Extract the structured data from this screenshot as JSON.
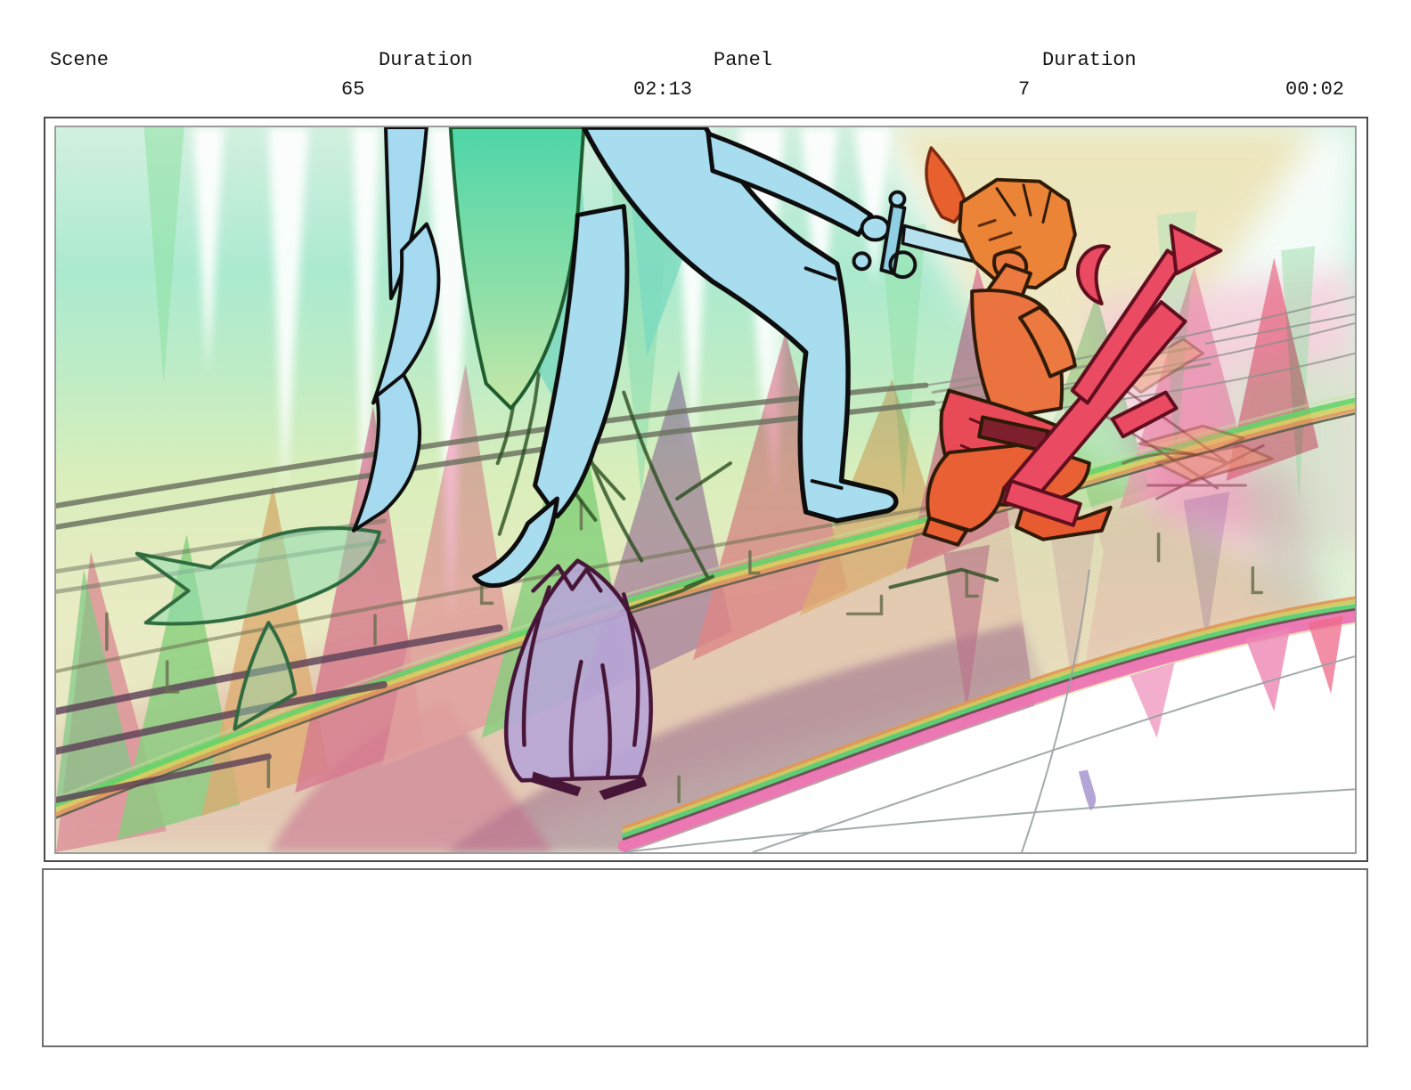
{
  "header": {
    "scene_label": "Scene",
    "scene_value": "65",
    "duration1_label": "Duration",
    "duration1_value": "02:13",
    "panel_label": "Panel",
    "panel_value": "7",
    "duration2_label": "Duration",
    "duration2_value": "00:02"
  },
  "notes": {
    "text": ""
  },
  "artwork": {
    "description": "Hand-drawn storyboard frame: a cyan figure with spiky teal hair strides down a slope thrusting a sword toward a kneeling orange horned demon who grips the blade and carries a red arrow-tipped weapon; a small purple cloaked figure stands lower among translucent pink, magenta, green and purple flame-like spikes; grey rail lines, thin wires and a rainbow band sweep diagonally toward the lower-right where the image fades to white with faint perspective lines.",
    "palette": {
      "mint_wash": "#abeacf",
      "yellow_wash": "#e9ebc3",
      "tan_wash": "#ece4ba",
      "pink_wash": "#f3ccd9",
      "teal_hair": "#57d9a2",
      "cyan_body": "#a8ddf0",
      "sword_blade": "#b6e0ee",
      "flame_pink": "#f49cc0",
      "flame_magenta": "#e668a6",
      "flame_green": "#7cd98c",
      "flame_orange": "#f0ac7c",
      "flame_mauve": "#ab7cc4",
      "deep_purple": "#8a4f9e",
      "demon_orange": "#ec8338",
      "demon_red": "#e84a58",
      "weapon_red": "#ea4a62",
      "cloak_purple": "#b7a5d7",
      "rail_olive": "#6e7462",
      "sketch_green": "#2a4d20",
      "frame_gray": "#4a4a4a"
    }
  }
}
